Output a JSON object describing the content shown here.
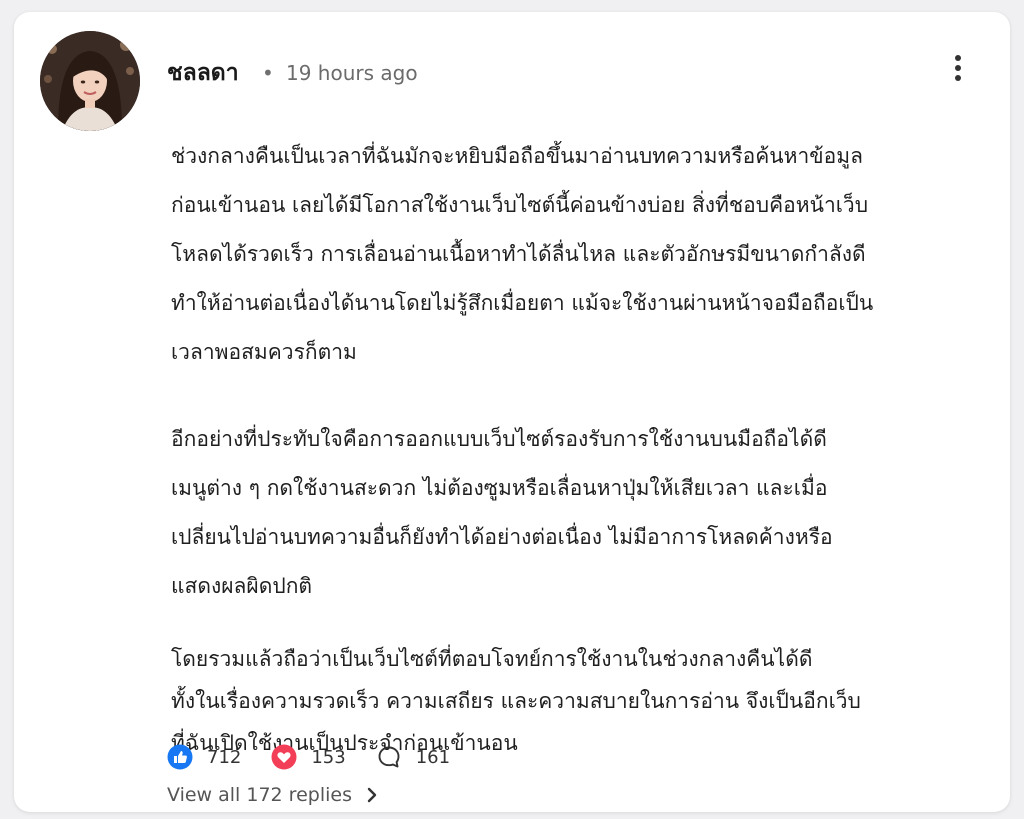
{
  "comment": {
    "author": "ชลลดา",
    "separator": "•",
    "timestamp": "19 hours ago",
    "avatar_icon": "avatar-photo",
    "menu_icon": "more-vertical-icon",
    "paragraphs": [
      {
        "lines": [
          "ช่วงกลางคืนเป็นเวลาที่ฉันมักจะหยิบมือถือขึ้นมาอ่านบทความหรือค้นหาข้อมูล",
          "ก่อนเข้านอน เลยได้มีโอกาสใช้งานเว็บไซต์นี้ค่อนข้างบ่อย สิ่งที่ชอบคือหน้าเว็บ",
          "โหลดได้รวดเร็ว การเลื่อนอ่านเนื้อหาทำได้ลื่นไหล และตัวอักษรมีขนาดกำลังดี",
          "ทำให้อ่านต่อเนื่องได้นานโดยไม่รู้สึกเมื่อยตา แม้จะใช้งานผ่านหน้าจอมือถือเป็น",
          "เวลาพอสมควรก็ตาม"
        ]
      },
      {
        "lines": [
          "อีกอย่างที่ประทับใจคือการออกแบบเว็บไซต์รองรับการใช้งานบนมือถือได้ดี",
          "เมนูต่าง ๆ กดใช้งานสะดวก ไม่ต้องซูมหรือเลื่อนหาปุ่มให้เสียเวลา และเมื่อ",
          "เปลี่ยนไปอ่านบทความอื่นก็ยังทำได้อย่างต่อเนื่อง ไม่มีอาการโหลดค้างหรือ",
          "แสดงผลผิดปกติ"
        ]
      },
      {
        "lines": [
          "โดยรวมแล้วถือว่าเป็นเว็บไซต์ที่ตอบโจทย์การใช้งานในช่วงกลางคืนได้ดี",
          "ทั้งในเรื่องความรวดเร็ว ความเสถียร และความสบายในการอ่าน จึงเป็นอีกเว็บ",
          "ที่ฉันเปิดใช้งานเป็นประจำก่อนเข้านอน"
        ]
      }
    ],
    "reactions": {
      "like": {
        "icon": "thumbs-up-icon",
        "count": "712",
        "color": "#1877f2"
      },
      "love": {
        "icon": "heart-icon",
        "count": "153",
        "color": "#f33e58"
      },
      "comments": {
        "icon": "comment-bubble-icon",
        "count": "161"
      }
    },
    "view_replies": {
      "label": "View all 172 replies",
      "icon": "chevron-right-icon"
    }
  }
}
